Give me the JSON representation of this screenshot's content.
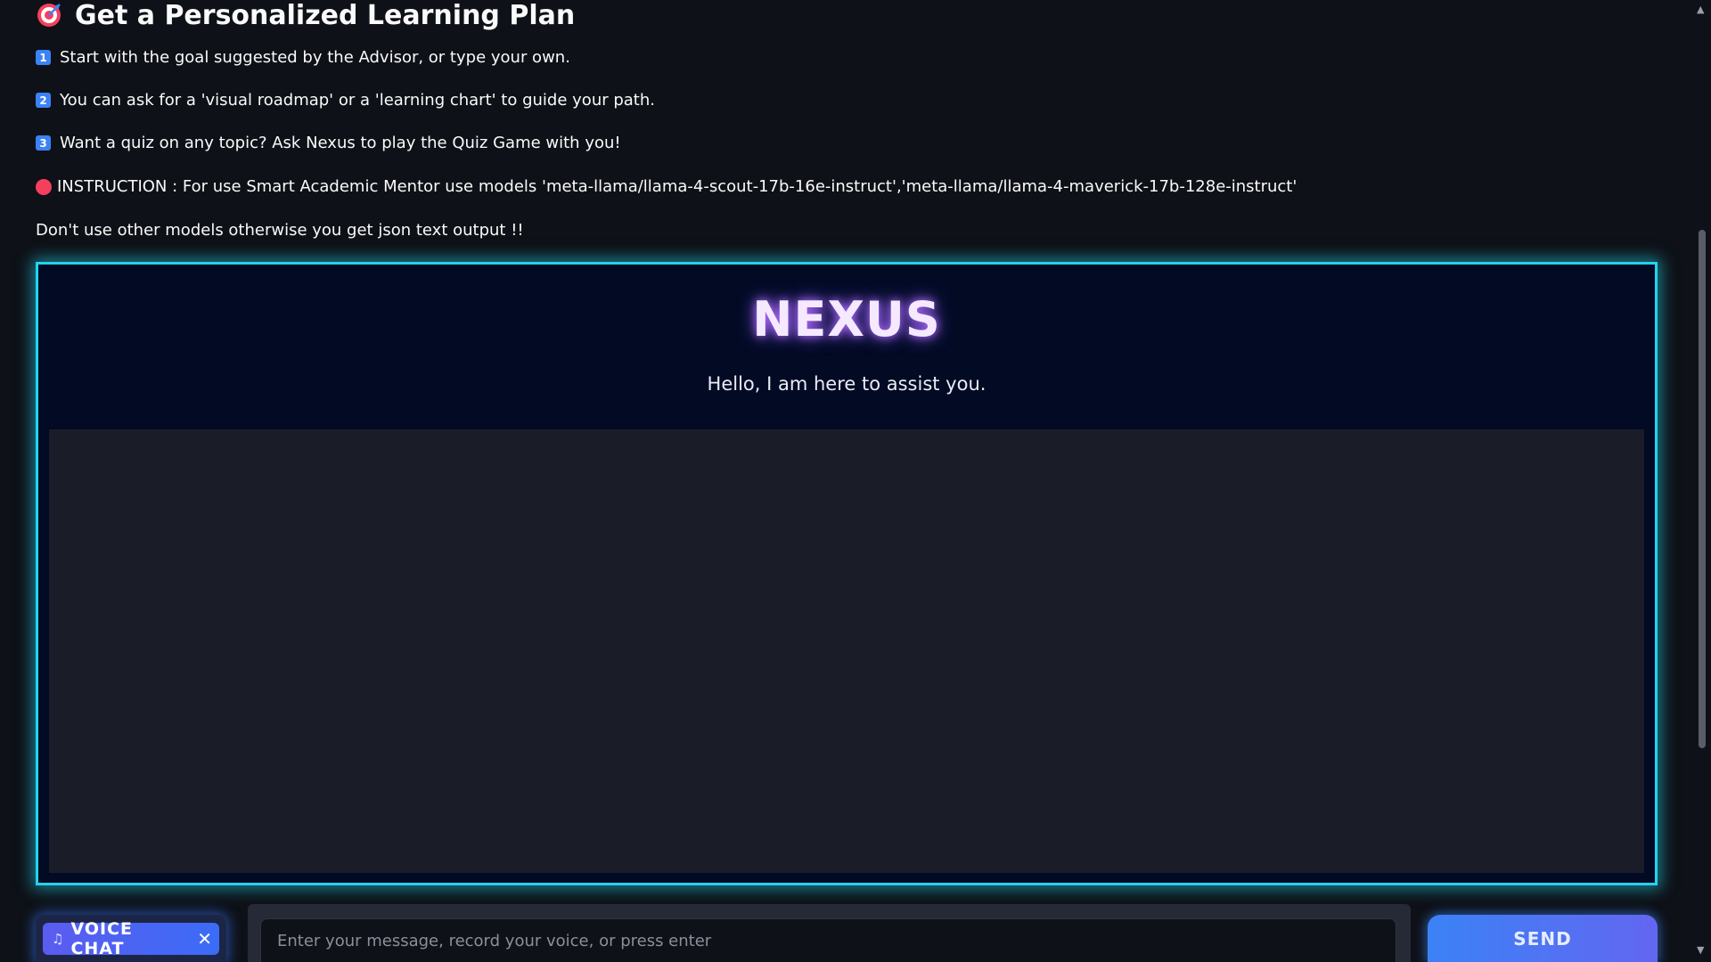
{
  "heading": {
    "icon": "target-icon",
    "title": "Get a Personalized Learning Plan"
  },
  "instructions": [
    {
      "badge": "1",
      "text": "Start with the goal suggested by the Advisor, or type your own."
    },
    {
      "badge": "2",
      "text": "You can ask for a 'visual roadmap' or a 'learning chart' to guide your path."
    },
    {
      "badge": "3",
      "text": "Want a quiz on any topic? Ask Nexus to play the Quiz Game with you!"
    }
  ],
  "notice": {
    "icon": "red-circle-icon",
    "text": "INSTRUCTION : For use Smart Academic Mentor use models 'meta-llama/llama-4-scout-17b-16e-instruct','meta-llama/llama-4-maverick-17b-128e-instruct'"
  },
  "warning": "Don't use other models otherwise you get json text output !!",
  "chat": {
    "brand": "NEXUS",
    "greeting": "Hello, I am here to assist you."
  },
  "controls": {
    "voice_label": "VOICE CHAT",
    "voice_icon": "music-note-icon",
    "voice_close": "✕",
    "input_placeholder": "Enter your message, record your voice, or press enter",
    "input_value": "",
    "send_label": "SEND"
  },
  "colors": {
    "background": "#0e1117",
    "frame_glow": "#22d3ee",
    "brand_glow": "#b46cff",
    "send_start": "#3b82f6",
    "send_end": "#6366f1"
  }
}
